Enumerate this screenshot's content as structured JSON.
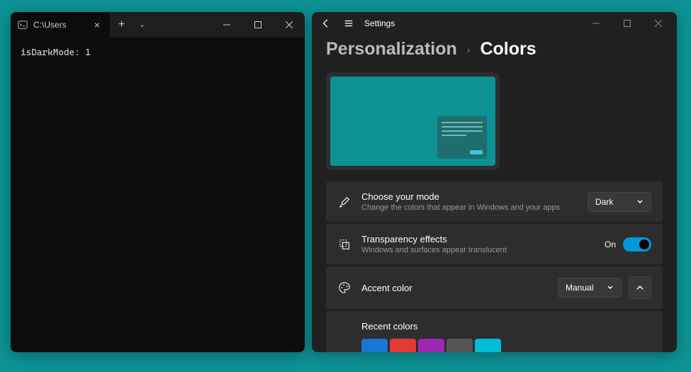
{
  "terminal": {
    "tab_title": "C:\\Users",
    "output": "isDarkMode: 1"
  },
  "settings": {
    "app_title": "Settings",
    "breadcrumb_parent": "Personalization",
    "breadcrumb_current": "Colors",
    "mode_row": {
      "title": "Choose your mode",
      "subtitle": "Change the colors that appear in Windows and your apps",
      "value": "Dark"
    },
    "transparency_row": {
      "title": "Transparency effects",
      "subtitle": "Windows and surfaces appear translucent",
      "state_label": "On"
    },
    "accent_row": {
      "title": "Accent color",
      "value": "Manual"
    },
    "recent_colors": {
      "title": "Recent colors",
      "swatches": [
        "#1976d2",
        "#e53935",
        "#9c27b0",
        "#555555",
        "#00bcd4"
      ]
    }
  }
}
